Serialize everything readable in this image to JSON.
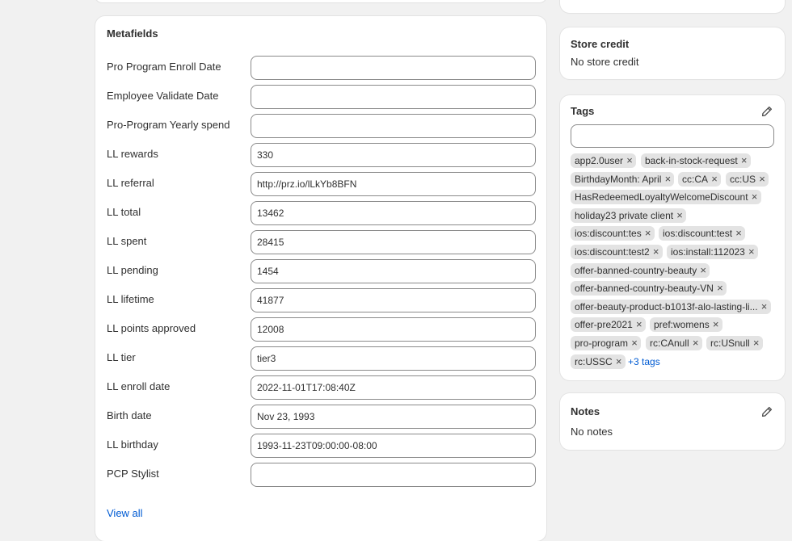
{
  "metafields": {
    "title": "Metafields",
    "rows": [
      {
        "label": "Pro Program Enroll Date",
        "value": ""
      },
      {
        "label": "Employee Validate Date",
        "value": ""
      },
      {
        "label": "Pro-Program Yearly spend",
        "value": ""
      },
      {
        "label": "LL rewards",
        "value": "330"
      },
      {
        "label": "LL referral",
        "value": "http://prz.io/lLkYb8BFN"
      },
      {
        "label": "LL total",
        "value": "13462"
      },
      {
        "label": "LL spent",
        "value": "28415"
      },
      {
        "label": "LL pending",
        "value": "1454"
      },
      {
        "label": "LL lifetime",
        "value": "41877"
      },
      {
        "label": "LL points approved",
        "value": "12008"
      },
      {
        "label": "LL tier",
        "value": "tier3"
      },
      {
        "label": "LL enroll date",
        "value": "2022-11-01T17:08:40Z"
      },
      {
        "label": "Birth date",
        "value": "Nov 23, 1993"
      },
      {
        "label": "LL birthday",
        "value": "1993-11-23T09:00:00-08:00"
      },
      {
        "label": "PCP Stylist",
        "value": ""
      }
    ],
    "view_all": "View all"
  },
  "store_credit": {
    "title": "Store credit",
    "value": "No store credit"
  },
  "tags": {
    "title": "Tags",
    "input_value": "",
    "items": [
      "app2.0user",
      "back-in-stock-request",
      "BirthdayMonth: April",
      "cc:CA",
      "cc:US",
      "HasRedeemedLoyaltyWelcomeDiscount",
      "holiday23 private client",
      "ios:discount:tes",
      "ios:discount:test",
      "ios:discount:test2",
      "ios:install:112023",
      "offer-banned-country-beauty",
      "offer-banned-country-beauty-VN",
      "offer-beauty-product-b1013f-alo-lasting-li...",
      "offer-pre2021",
      "pref:womens",
      "pro-program",
      "rc:CAnull",
      "rc:USnull",
      "rc:USSC"
    ],
    "more_label": "+3 tags",
    "remove_glyph": "×"
  },
  "notes": {
    "title": "Notes",
    "value": "No notes"
  },
  "colors": {
    "background": "#f1f1f1",
    "card": "#ffffff",
    "link": "#005bd3",
    "tag_bg": "#e3e3e3",
    "input_border": "#8a8a8a"
  },
  "icons": {
    "tags_edit": "pencil-icon",
    "notes_edit": "pencil-icon",
    "tag_remove": "close-icon"
  }
}
